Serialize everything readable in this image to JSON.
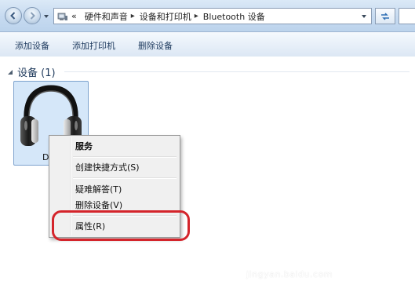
{
  "address_bar": {
    "overflow_chevron": "«",
    "breadcrumbs": [
      "硬件和声音",
      "设备和打印机",
      "Bluetooth 设备"
    ],
    "separator": "▸"
  },
  "toolbar": {
    "add_device": "添加设备",
    "add_printer": "添加打印机",
    "remove_device": "删除设备"
  },
  "device_group": {
    "header": "设备 (1)",
    "device": {
      "label": "Di",
      "icon": "headphones-icon",
      "selected": true
    }
  },
  "context_menu": {
    "items": [
      {
        "label": "服务",
        "bold": true
      },
      {
        "label": "创建快捷方式(S)"
      },
      {
        "label": "疑难解答(T)"
      },
      {
        "label": "删除设备(V)"
      },
      {
        "label": "属性(R)",
        "circled": true
      }
    ]
  },
  "colors": {
    "highlight_ring": "#d4242b",
    "selection_fill": "#d5e7f9",
    "selection_border": "#7da2ce"
  },
  "watermark": "jingyan.baidu.com"
}
